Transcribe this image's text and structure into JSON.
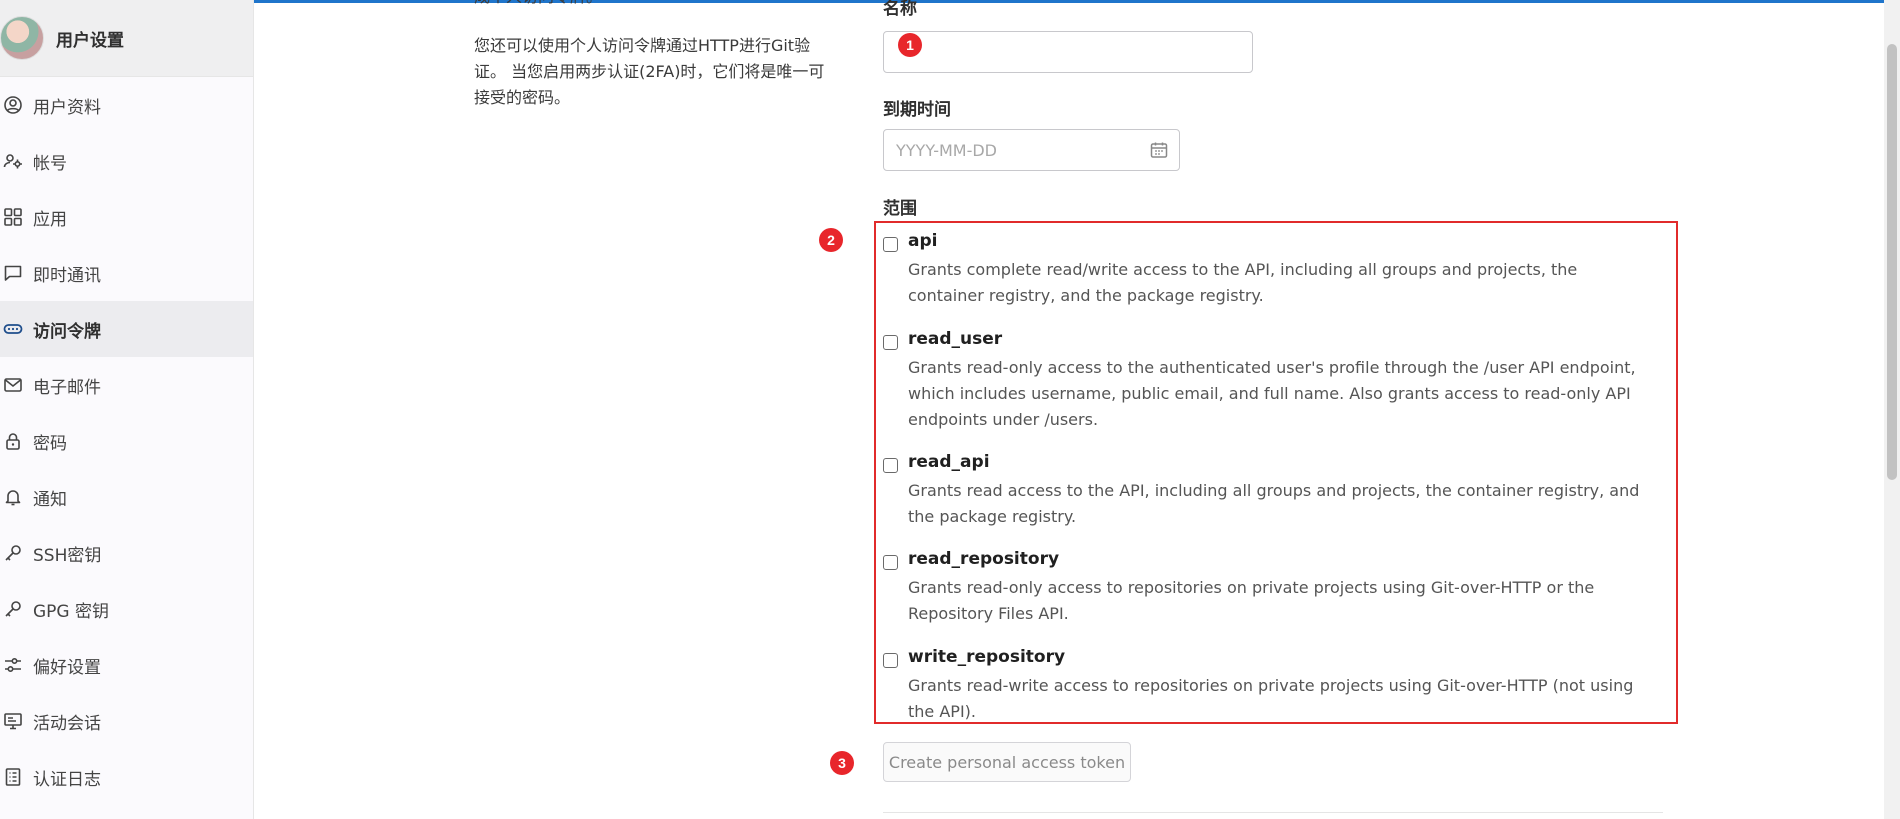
{
  "sidebar": {
    "title": "用户设置",
    "items": [
      {
        "label": "用户资料",
        "icon": "user-circle-icon"
      },
      {
        "label": "帐号",
        "icon": "user-gear-icon"
      },
      {
        "label": "应用",
        "icon": "grid-icon"
      },
      {
        "label": "即时通讯",
        "icon": "chat-icon"
      },
      {
        "label": "访问令牌",
        "icon": "token-icon",
        "active": true
      },
      {
        "label": "电子邮件",
        "icon": "mail-icon"
      },
      {
        "label": "密码",
        "icon": "lock-icon"
      },
      {
        "label": "通知",
        "icon": "bell-icon"
      },
      {
        "label": "SSH密钥",
        "icon": "key-icon"
      },
      {
        "label": "GPG 密钥",
        "icon": "key-icon"
      },
      {
        "label": "偏好设置",
        "icon": "sliders-icon"
      },
      {
        "label": "活动会话",
        "icon": "monitor-icon"
      },
      {
        "label": "认证日志",
        "icon": "log-icon"
      }
    ]
  },
  "description": {
    "cut_line": "成个人访问令牌。",
    "paragraph": "您还可以使用个人访问令牌通过HTTP进行Git验证。 当您启用两步认证(2FA)时，它们将是唯一可接受的密码。"
  },
  "form": {
    "name_label": "名称",
    "name_value": "",
    "expiry_label": "到期时间",
    "expiry_placeholder": "YYYY-MM-DD",
    "scope_label": "范围",
    "scopes": [
      {
        "name": "api",
        "text": "Grants complete read/write access to the API, including all groups and projects, the container registry, and the package registry."
      },
      {
        "name": "read_user",
        "text": "Grants read-only access to the authenticated user's profile through the /user API endpoint, which includes username, public email, and full name. Also grants access to read-only API endpoints under /users."
      },
      {
        "name": "read_api",
        "text": "Grants read access to the API, including all groups and projects, the container registry, and the package registry."
      },
      {
        "name": "read_repository",
        "text": "Grants read-only access to repositories on private projects using Git-over-HTTP or the Repository Files API."
      },
      {
        "name": "write_repository",
        "text": "Grants read-write access to repositories on private projects using Git-over-HTTP (not using the API)."
      }
    ],
    "create_button": "Create personal access token"
  },
  "annotations": {
    "badge1": "1",
    "badge2": "2",
    "badge3": "3",
    "highlight_color": "#e12b2b"
  },
  "colors": {
    "accent": "#1f75cb",
    "sidebar_bg": "#fbfafd",
    "active_item_bg": "#ececef"
  }
}
